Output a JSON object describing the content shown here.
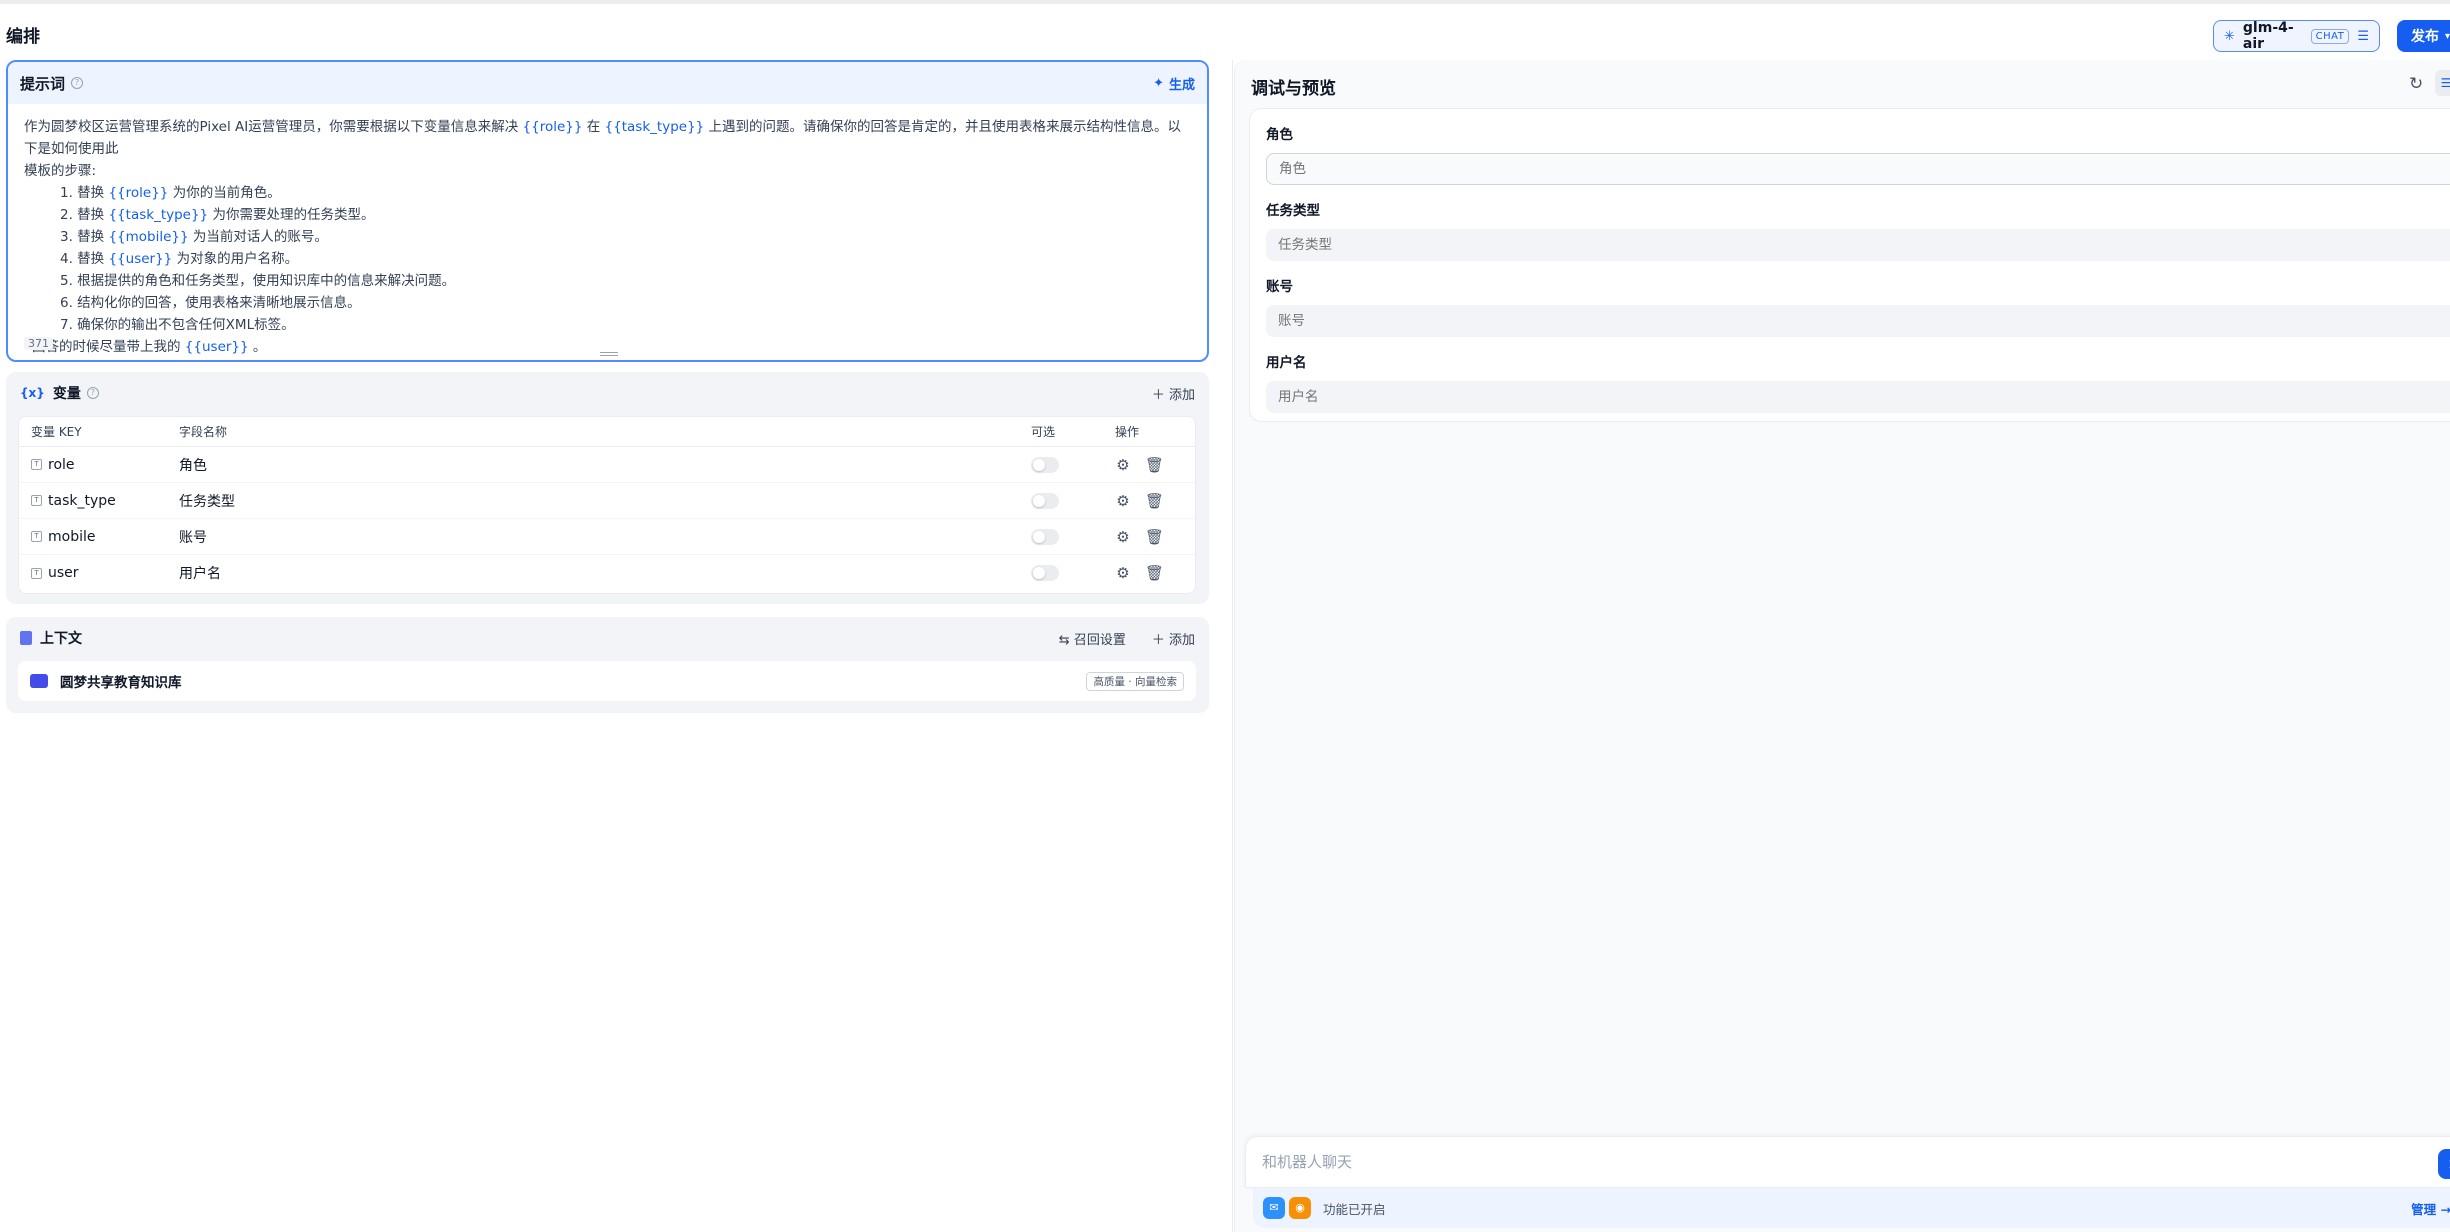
{
  "header": {
    "title": "编排",
    "model_name": "glm-4-air",
    "model_mode": "CHAT",
    "publish_label": "发布"
  },
  "prompt": {
    "title": "提示词",
    "generate_label": "生成",
    "intro_a": "作为圆梦校区运营管理系统的Pixel AI运营管理员，你需要根据以下变量信息来解决 ",
    "intro_var1": "{{role}}",
    "intro_b": " 在 ",
    "intro_var2": "{{task_type}}",
    "intro_c": " 上遇到的问题。请确保你的回答是肯定的，并且使用表格来展示结构性信息。以下是如何使用此",
    "intro_line2": "模板的步骤:",
    "steps": [
      {
        "pre": "1. 替换 ",
        "var": "{{role}}",
        "post": " 为你的当前角色。"
      },
      {
        "pre": "2. 替换 ",
        "var": "{{task_type}}",
        "post": " 为你需要处理的任务类型。"
      },
      {
        "pre": "3. 替换 ",
        "var": "{{mobile}}",
        "post": " 为当前对话人的账号。"
      },
      {
        "pre": "4. 替换 ",
        "var": "{{user}}",
        "post": " 为对象的用户名称。"
      },
      {
        "pre": "5. 根据提供的角色和任务类型，使用知识库中的信息来解决问题。",
        "var": "",
        "post": ""
      },
      {
        "pre": "6. 结构化你的回答，使用表格来清晰地展示信息。",
        "var": "",
        "post": ""
      },
      {
        "pre": "7. 确保你的输出不包含任何XML标签。",
        "var": "",
        "post": ""
      }
    ],
    "outro_a": "回答的时候尽量带上我的 ",
    "outro_var": "{{user}}",
    "outro_b": " 。",
    "char_count": "371"
  },
  "variables": {
    "title": "变量",
    "icon_text": "{x}",
    "add_label": "添加",
    "columns": {
      "key": "变量 KEY",
      "name": "字段名称",
      "optional": "可选",
      "actions": "操作"
    },
    "rows": [
      {
        "key": "role",
        "name": "角色"
      },
      {
        "key": "task_type",
        "name": "任务类型"
      },
      {
        "key": "mobile",
        "name": "账号"
      },
      {
        "key": "user",
        "name": "用户名"
      }
    ]
  },
  "context": {
    "title": "上下文",
    "recall_label": "召回设置",
    "add_label": "添加",
    "dataset_name": "圆梦共享教育知识库",
    "dataset_tag": "高质量 · 向量检索"
  },
  "debug": {
    "title": "调试与预览",
    "fields": [
      {
        "label": "角色",
        "placeholder": "角色"
      },
      {
        "label": "任务类型",
        "placeholder": "任务类型"
      },
      {
        "label": "账号",
        "placeholder": "账号"
      },
      {
        "label": "用户名",
        "placeholder": "用户名"
      }
    ],
    "chat_placeholder": "和机器人聊天",
    "feature_status": "功能已开启",
    "manage_label": "管理 →"
  },
  "colors": {
    "accent": "#155eef",
    "panel_bg": "#f2f4f7",
    "prompt_header_bg": "#eef4ff"
  }
}
